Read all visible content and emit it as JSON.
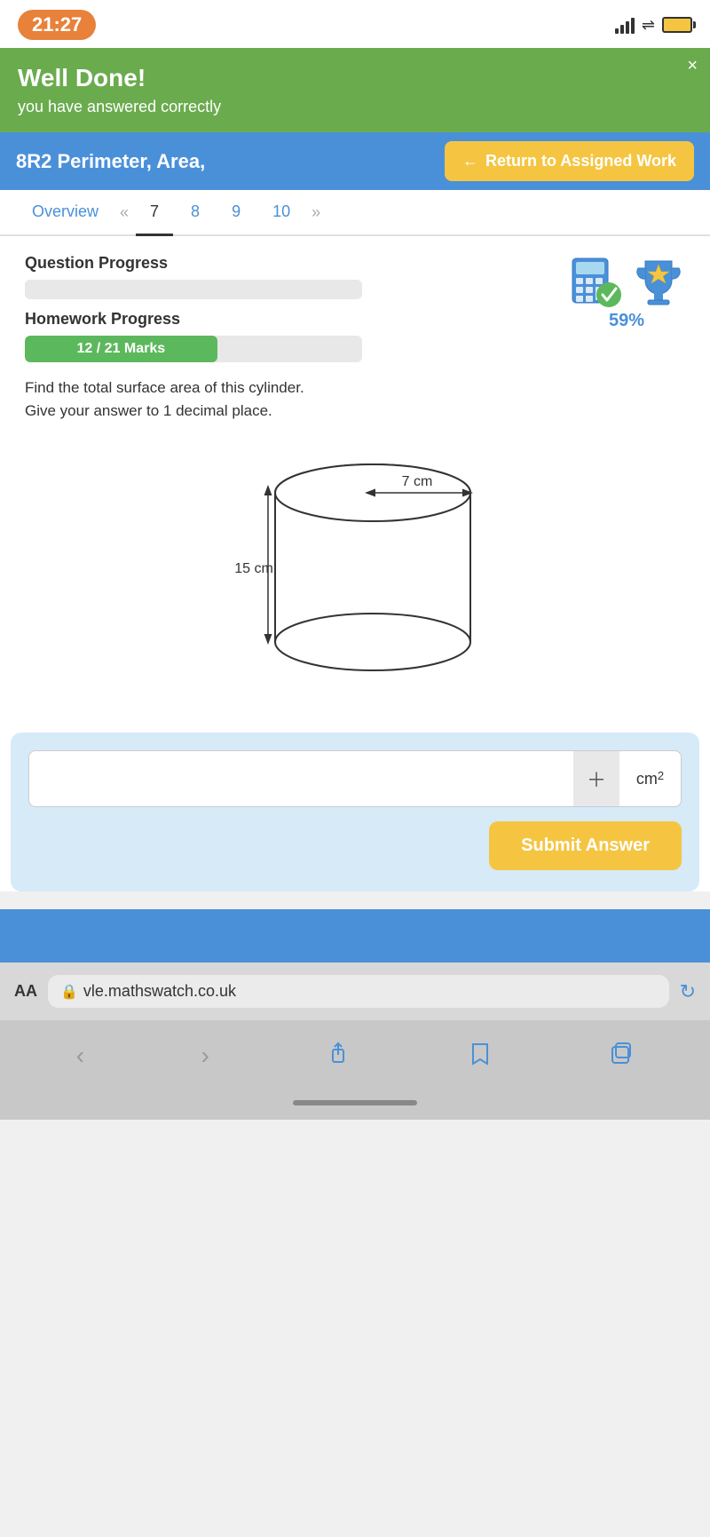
{
  "status_bar": {
    "time": "21:27"
  },
  "well_done": {
    "title": "Well Done!",
    "subtitle": "you have answered correctly",
    "close_label": "×"
  },
  "header": {
    "title": "8R2 Perimeter, Area,",
    "return_button": "Return to Assigned Work"
  },
  "tabs": {
    "overview": "Overview",
    "prev_arrow": "«",
    "tab7": "7",
    "tab8": "8",
    "tab9": "9",
    "tab10": "10",
    "next_arrow": "»"
  },
  "question_progress": {
    "label": "Question Progress"
  },
  "homework_progress": {
    "label": "Homework Progress",
    "marks": "12 / 21 Marks",
    "fill_percent": 57
  },
  "score": {
    "percent": "59%"
  },
  "question": {
    "text_line1": "Find the total surface area of this cylinder.",
    "text_line2": "Give your answer to 1 decimal place.",
    "radius_label": "7 cm",
    "height_label": "15 cm"
  },
  "answer": {
    "placeholder": "",
    "unit": "cm",
    "unit_power": "2",
    "submit_label": "Submit Answer"
  },
  "browser": {
    "aa": "AA",
    "lock": "🔒",
    "url": "vle.mathswatch.co.uk"
  }
}
